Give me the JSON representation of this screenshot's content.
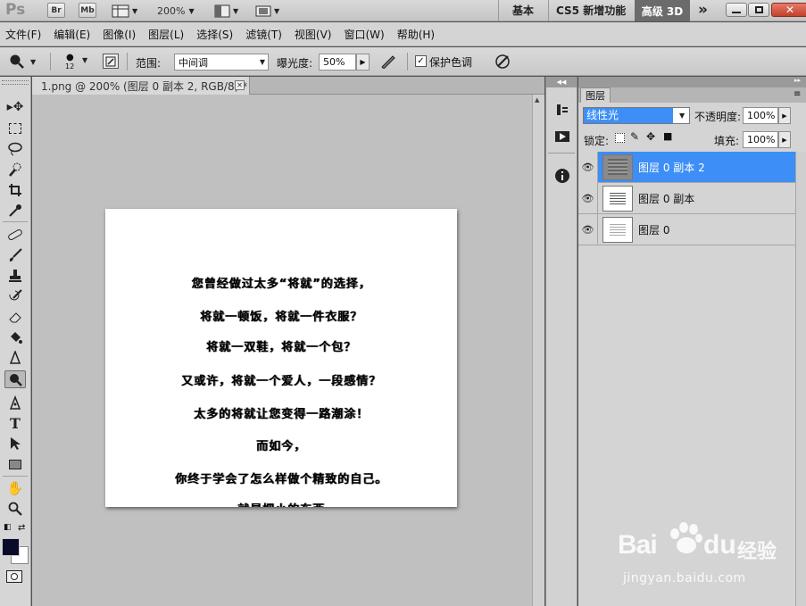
{
  "app": {
    "logo": "Ps",
    "bridge": "Br",
    "minibridge": "Mb",
    "zoom": "200%",
    "workspaces": [
      "基本",
      "CS5 新增功能",
      "高级 3D"
    ],
    "more": "»"
  },
  "menu": [
    "文件(F)",
    "编辑(E)",
    "图像(I)",
    "图层(L)",
    "选择(S)",
    "滤镜(T)",
    "视图(V)",
    "窗口(W)",
    "帮助(H)"
  ],
  "options": {
    "brush_size": "12",
    "range_label": "范围:",
    "range_value": "中间调",
    "exposure_label": "曝光度:",
    "exposure_value": "50%",
    "protect_label": "保护色调",
    "protect_checked": true
  },
  "document": {
    "tab_title": "1.png @ 200% (图层 0 副本 2, RGB/8) *",
    "lines": [
      "您曾经做过太多“将就”的选择，",
      "将就一顿饭，将就一件衣服？",
      "将就一双鞋，将就一个包？",
      "又或许，将就一个爱人，一段感情？",
      "太多的将就让您变得一路潮涂！",
      "而如今，",
      "你终于学会了怎么样做个精致的自己。",
      "就是把小的东西"
    ]
  },
  "layers_panel": {
    "tab": "图层",
    "blend_mode": "线性光",
    "opacity_label": "不透明度:",
    "opacity_value": "100%",
    "lock_label": "锁定:",
    "fill_label": "填充:",
    "fill_value": "100%",
    "layers": [
      {
        "name": "图层 0 副本 2",
        "selected": true
      },
      {
        "name": "图层 0 副本",
        "selected": false
      },
      {
        "name": "图层 0",
        "selected": false
      }
    ]
  },
  "watermark": {
    "brand": "Bai",
    "brand2": "du",
    "cn": "经验",
    "url": "jingyan.baidu.com"
  },
  "colors": {
    "selection": "#3d8ef6",
    "foreground": "#0a0a2a",
    "background": "#ffffff"
  }
}
